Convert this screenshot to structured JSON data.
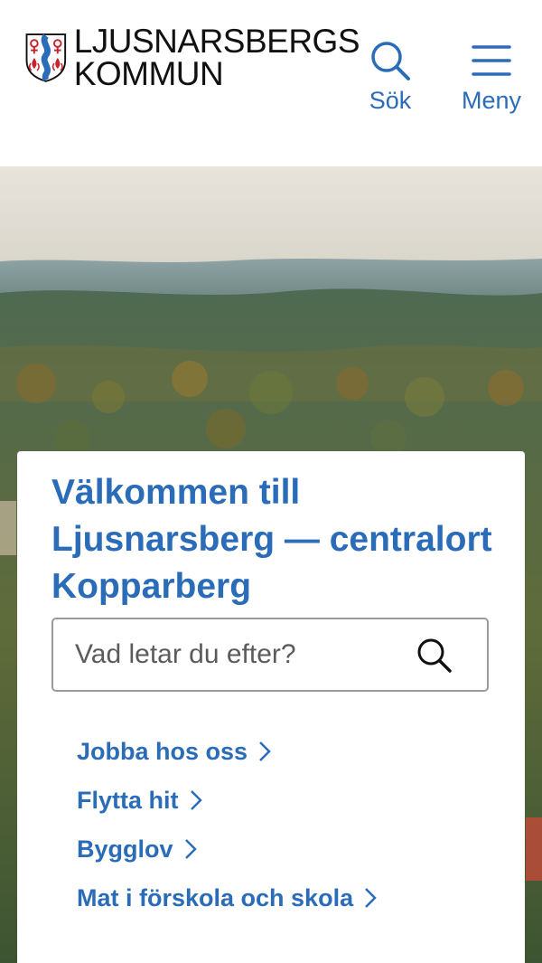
{
  "header": {
    "logo_line1": "LJUSNARSBERGS",
    "logo_line2": "KOMMUN",
    "search_label": "Sök",
    "menu_label": "Meny"
  },
  "welcome": {
    "title": "Välkommen till Ljusnarsberg — centralort Kopparberg"
  },
  "search": {
    "placeholder": "Vad letar du efter?"
  },
  "quick_links": [
    {
      "label": "Jobba hos oss"
    },
    {
      "label": "Flytta hit"
    },
    {
      "label": "Bygglov"
    },
    {
      "label": "Mat i förskola och skola"
    }
  ],
  "colors": {
    "brand_blue": "#2b6cb8",
    "shield_red": "#c8232c",
    "shield_blue": "#2b6cb8"
  },
  "icons": {
    "search": "magnifier-icon",
    "menu": "hamburger-icon",
    "chevron": "chevron-right-icon"
  }
}
